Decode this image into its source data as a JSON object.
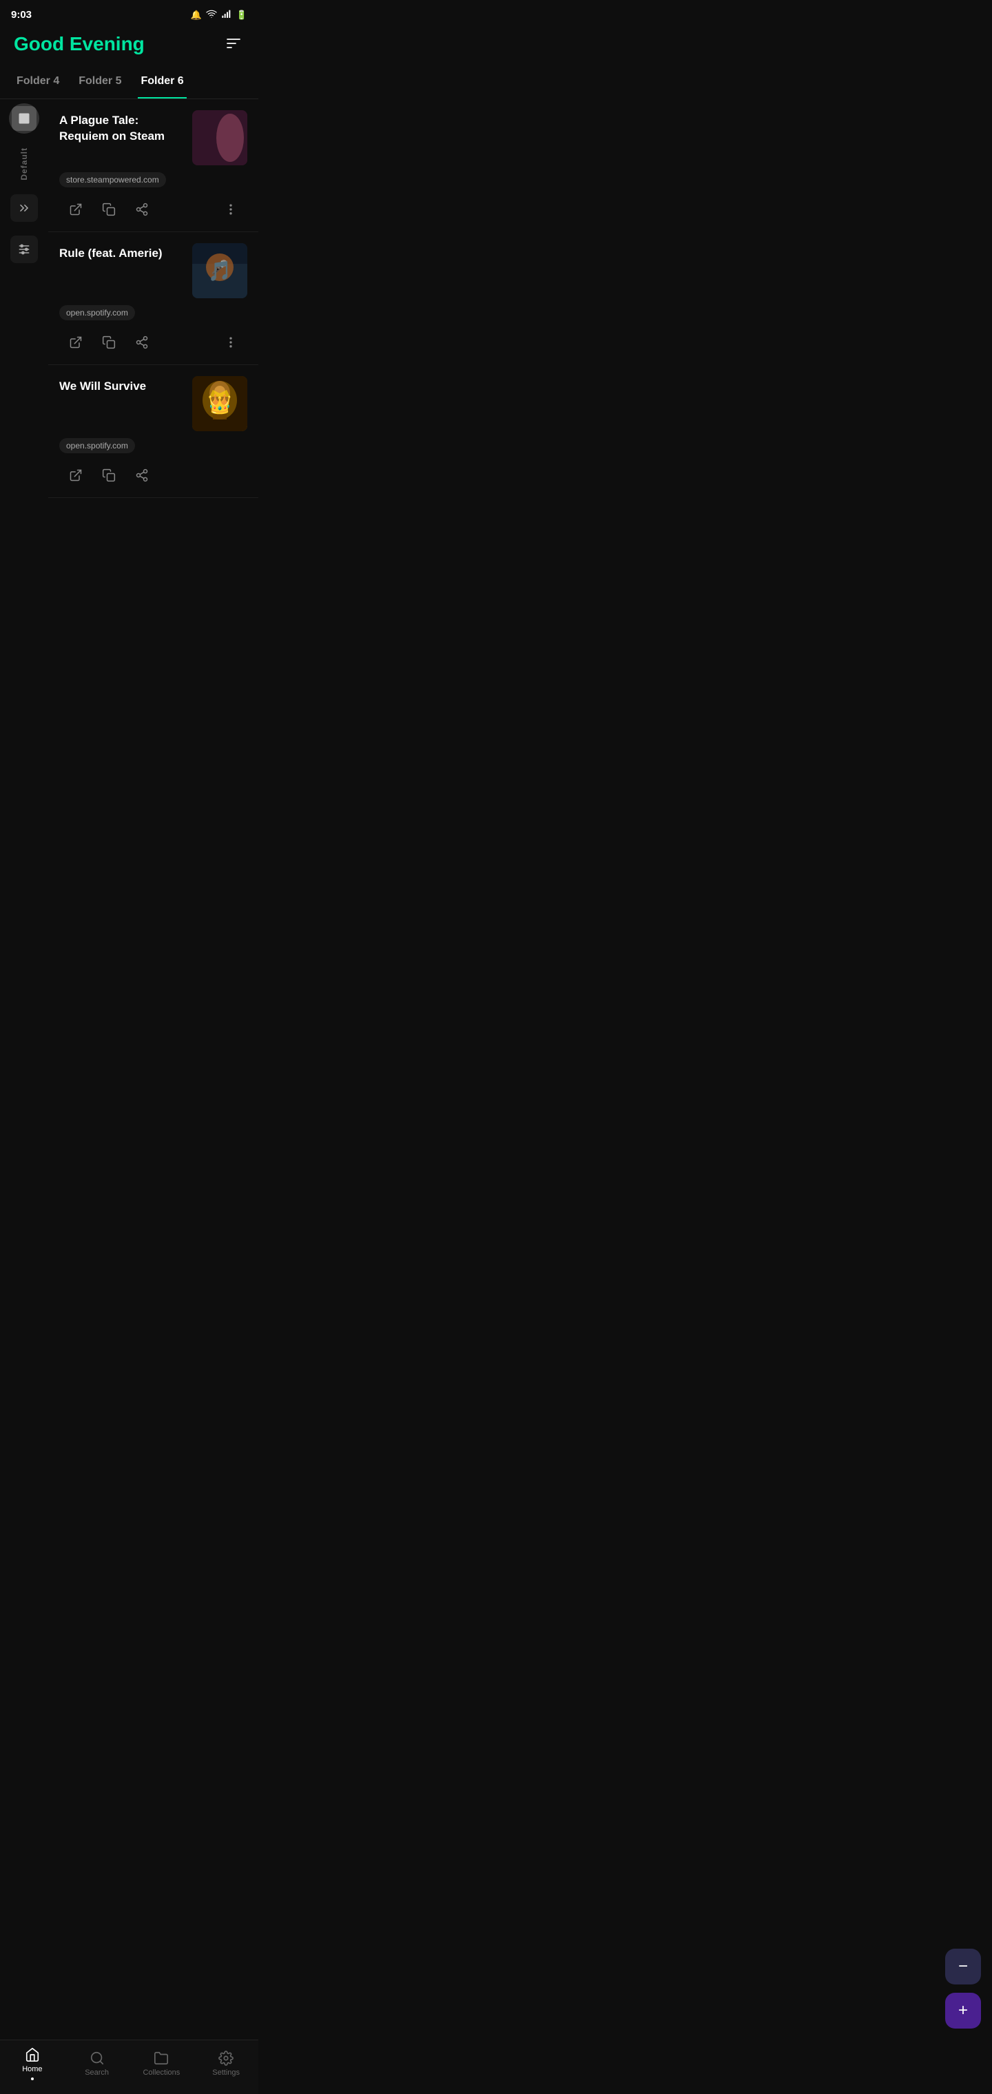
{
  "statusBar": {
    "time": "9:03",
    "icons": [
      "notification",
      "wifi",
      "signal",
      "battery"
    ]
  },
  "header": {
    "title": "Good Evening",
    "filterIcon": "≡"
  },
  "tabs": [
    {
      "id": "folder4",
      "label": "Folder 4",
      "active": false
    },
    {
      "id": "folder5",
      "label": "Folder 5",
      "active": false
    },
    {
      "id": "folder6",
      "label": "Folder 6",
      "active": true
    }
  ],
  "sidebar": {
    "label": "Default",
    "avatarIcon": "📄",
    "iconBtn": "◈",
    "filterBtn": "⊞"
  },
  "bookmarks": [
    {
      "id": "bookmark-plague",
      "title": "A Plague Tale: Requiem on Steam",
      "domain": "store.steampowered.com",
      "thumbType": "plague"
    },
    {
      "id": "bookmark-rule",
      "title": "Rule (feat. Amerie)",
      "domain": "open.spotify.com",
      "thumbType": "rule"
    },
    {
      "id": "bookmark-survive",
      "title": "We Will Survive",
      "domain": "open.spotify.com",
      "thumbType": "survive"
    }
  ],
  "actions": {
    "open": "open-icon",
    "copy": "copy-icon",
    "share": "share-icon",
    "more": "more-icon"
  },
  "fab": {
    "minus": "−",
    "plus": "+"
  },
  "bottomNav": [
    {
      "id": "home",
      "label": "Home",
      "active": true
    },
    {
      "id": "search",
      "label": "Search",
      "active": false
    },
    {
      "id": "collections",
      "label": "Collections",
      "active": false
    },
    {
      "id": "settings",
      "label": "Settings",
      "active": false
    }
  ]
}
